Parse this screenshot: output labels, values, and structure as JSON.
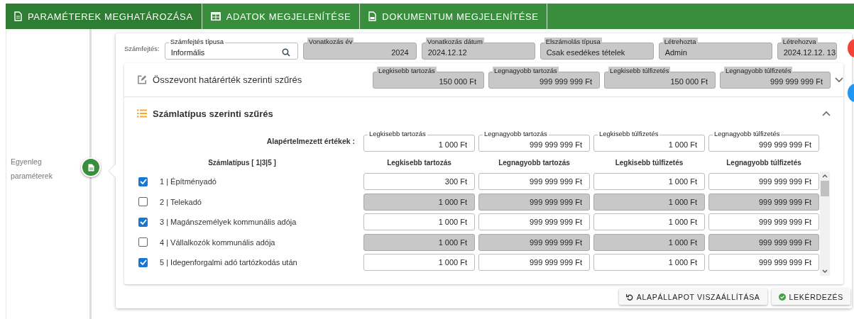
{
  "tabs": [
    {
      "label": "PARAMÉTEREK MEGHATÁROZÁSA",
      "selected": true
    },
    {
      "label": "ADATOK MEGJELENÍTÉSE",
      "selected": false
    },
    {
      "label": "DOKUMENTUM MEGJELENÍTÉSE",
      "selected": false
    }
  ],
  "sidebar": {
    "step_label": "Egyenleg paraméterek"
  },
  "header": {
    "label": "Számfejtés:",
    "fields": [
      {
        "label": "Számfejtés típusa",
        "value": "Informális",
        "kind": "search",
        "disabled": false
      },
      {
        "label": "Vonatkozás év",
        "value": "2024",
        "kind": "number",
        "disabled": true
      },
      {
        "label": "Vonatkozás dátum",
        "value": "2024.12.12",
        "kind": "text",
        "disabled": true
      },
      {
        "label": "Elszámolás típusa",
        "value": "Csak esedékes tételek",
        "kind": "text",
        "disabled": true
      },
      {
        "label": "Létrehozta",
        "value": "Admin",
        "kind": "text",
        "disabled": true
      },
      {
        "label": "Létrehozva",
        "value": "2024.12.12. 13",
        "kind": "text",
        "disabled": true
      }
    ]
  },
  "summary_filter": {
    "title": "Összevont határérték szerinti szűrés",
    "expanded": false,
    "fields": [
      {
        "label": "Legkisebb tartozás",
        "value": "150 000 Ft",
        "disabled": true
      },
      {
        "label": "Legnagyobb tartozás",
        "value": "999 999 999 Ft",
        "disabled": true
      },
      {
        "label": "Legkisebb túlfizetés",
        "value": "150 000 Ft",
        "disabled": true
      },
      {
        "label": "Legnagyobb túlfizetés",
        "value": "999 999 999 Ft",
        "disabled": true
      }
    ]
  },
  "type_filter": {
    "title": "Számlatípus szerinti szűrés",
    "expanded": true,
    "defaults_label": "Alapértelmezett értékek :",
    "defaults": [
      {
        "label": "Legkisebb tartozás",
        "value": "1 000 Ft",
        "disabled": false
      },
      {
        "label": "Legnagyobb tartozás",
        "value": "999 999 999 Ft",
        "disabled": false
      },
      {
        "label": "Legkisebb túlfizetés",
        "value": "1 000 Ft",
        "disabled": false
      },
      {
        "label": "Legnagyobb túlfizetés",
        "value": "999 999 999 Ft",
        "disabled": false
      }
    ],
    "columns": [
      "Számlatípus [ 1|3|5 ]",
      "Legkisebb tartozás",
      "Legnagyobb tartozás",
      "Legkisebb túlfizetés",
      "Legnagyobb túlfizetés"
    ],
    "rows": [
      {
        "label": "1 | Építményadó",
        "checked": true,
        "values": [
          "300 Ft",
          "999 999 999 Ft",
          "1 000 Ft",
          "999 999 999 Ft"
        ]
      },
      {
        "label": "2 | Telekadó",
        "checked": false,
        "values": [
          "1 000 Ft",
          "999 999 999 Ft",
          "1 000 Ft",
          "999 999 999 Ft"
        ]
      },
      {
        "label": "3 | Magánszemélyek kommunális adója",
        "checked": true,
        "values": [
          "1 000 Ft",
          "999 999 999 Ft",
          "1 000 Ft",
          "999 999 999 Ft"
        ]
      },
      {
        "label": "4 | Vállalkozók kommunális adója",
        "checked": false,
        "values": [
          "1 000 Ft",
          "999 999 999 Ft",
          "1 000 Ft",
          "999 999 999 Ft"
        ]
      },
      {
        "label": "5 | Idegenforgalmi adó tartózkodás után",
        "checked": true,
        "values": [
          "1 000 Ft",
          "999 999 999 Ft",
          "1 000 Ft",
          "999 999 999 Ft"
        ]
      }
    ]
  },
  "buttons": [
    {
      "label": "ALAPÁLLAPOT VISZAÁLLÍTÁSA",
      "kind": "reset"
    },
    {
      "label": "LEKÉRDEZÉS",
      "kind": "query"
    }
  ]
}
